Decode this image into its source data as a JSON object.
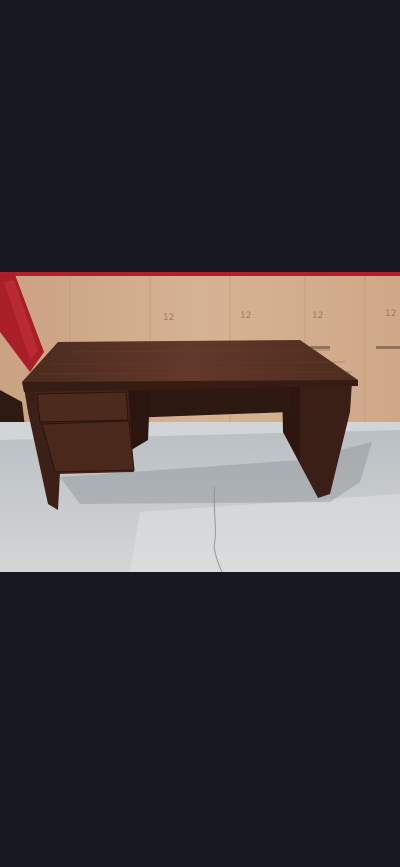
{
  "photo": {
    "subject_icon": "desk-icon",
    "wall_stamps": [
      "12",
      "12",
      "12",
      "12"
    ],
    "colors": {
      "background": "#161a20",
      "desk_top": "#5a3527",
      "desk_body": "#3e2118",
      "wall": "#d2ad8c",
      "floor": "#c6cacc",
      "wrap": "#b0222a"
    }
  }
}
